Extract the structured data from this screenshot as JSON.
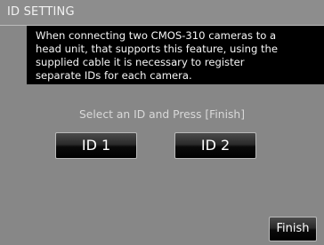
{
  "header": {
    "title": "ID SETTING"
  },
  "message": {
    "lines": [
      "When connecting two CMOS-310 cameras to a",
      "head unit, that supports this feature, using the",
      "supplied cable it is necessary to register",
      "separate IDs for each camera."
    ]
  },
  "prompt": "Select an ID and Press [Finish]",
  "buttons": {
    "id1": "ID 1",
    "id2": "ID 2",
    "finish": "Finish"
  }
}
